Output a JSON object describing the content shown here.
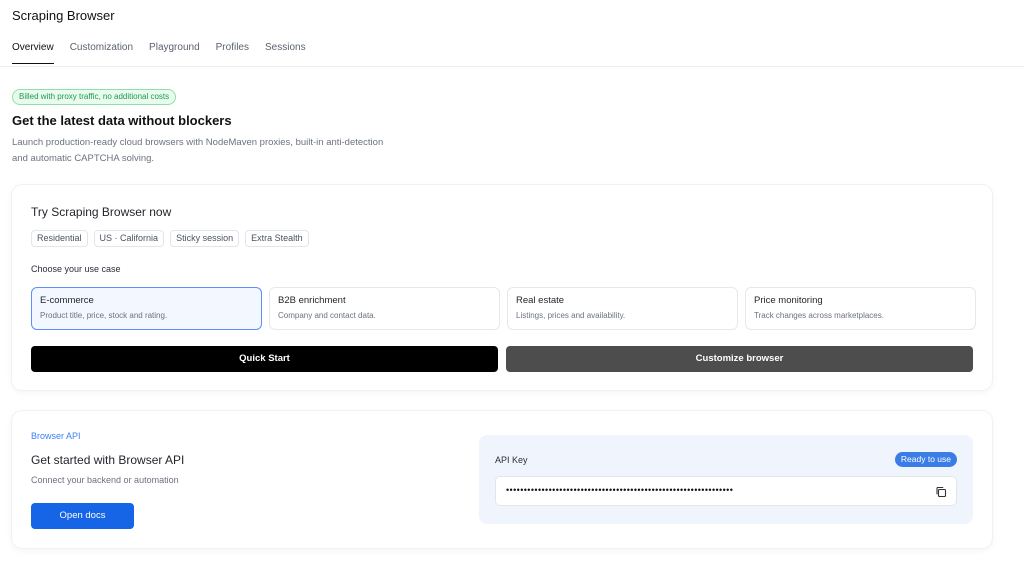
{
  "app": {
    "title": "Scraping Browser"
  },
  "tabs": [
    {
      "label": "Overview",
      "active": true
    },
    {
      "label": "Customization",
      "active": false
    },
    {
      "label": "Playground",
      "active": false
    },
    {
      "label": "Profiles",
      "active": false
    },
    {
      "label": "Sessions",
      "active": false
    }
  ],
  "hero": {
    "badge": "Billed with proxy traffic, no additional costs",
    "title": "Get the latest data without blockers",
    "description_line1": "Launch production-ready cloud browsers with NodeMaven proxies, built-in anti-detection",
    "description_line2": "and automatic CAPTCHA solving."
  },
  "try_card": {
    "title": "Try Scraping Browser now",
    "chips": [
      "Residential",
      "US · California",
      "Sticky session",
      "Extra Stealth"
    ],
    "use_case_label": "Choose your use case",
    "use_cases": [
      {
        "title": "E-commerce",
        "desc": "Product title, price, stock and rating.",
        "selected": true
      },
      {
        "title": "B2B enrichment",
        "desc": "Company and contact data.",
        "selected": false
      },
      {
        "title": "Real estate",
        "desc": "Listings, prices and availability.",
        "selected": false
      },
      {
        "title": "Price monitoring",
        "desc": "Track changes across marketplaces.",
        "selected": false
      }
    ],
    "quick_start_label": "Quick Start",
    "customize_label": "Customize browser"
  },
  "api_card": {
    "tag": "Browser API",
    "title": "Get started with Browser API",
    "subtitle": "Connect your backend or automation",
    "open_docs_label": "Open docs",
    "key_label": "API Key",
    "status": "Ready to use",
    "key_masked": "••••••••••••••••••••••••••••••••••••••••••••••••••••••••••••••••",
    "copy_icon": "copy-icon"
  },
  "colors": {
    "accent_blue": "#1565e6",
    "badge_green": "#1f9a4c",
    "selected_border": "#5b8ff9"
  }
}
